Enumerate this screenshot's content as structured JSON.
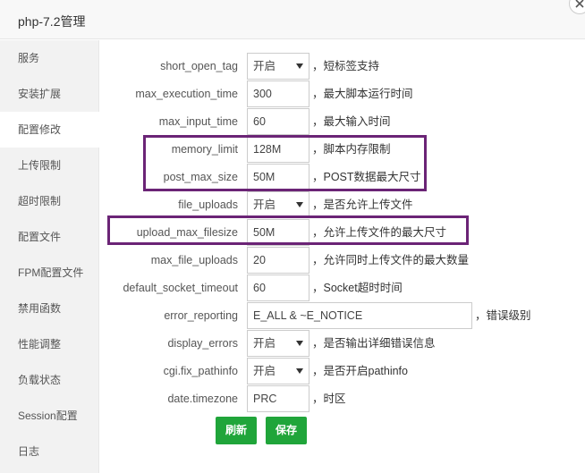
{
  "window": {
    "title": "php-7.2管理"
  },
  "sidebar": {
    "items": [
      {
        "label": "服务"
      },
      {
        "label": "安装扩展"
      },
      {
        "label": "配置修改"
      },
      {
        "label": "上传限制"
      },
      {
        "label": "超时限制"
      },
      {
        "label": "配置文件"
      },
      {
        "label": "FPM配置文件"
      },
      {
        "label": "禁用函数"
      },
      {
        "label": "性能调整"
      },
      {
        "label": "负载状态"
      },
      {
        "label": "Session配置"
      },
      {
        "label": "日志"
      }
    ]
  },
  "form": {
    "rows": [
      {
        "name": "short_open_tag",
        "type": "select",
        "value": "开启",
        "hint": "，短标签支持"
      },
      {
        "name": "max_execution_time",
        "type": "input",
        "value": "300",
        "hint": "，最大脚本运行时间"
      },
      {
        "name": "max_input_time",
        "type": "input",
        "value": "60",
        "hint": "，最大输入时间"
      },
      {
        "name": "memory_limit",
        "type": "input",
        "value": "128M",
        "hint": "，脚本内存限制"
      },
      {
        "name": "post_max_size",
        "type": "input",
        "value": "50M",
        "hint": "，POST数据最大尺寸"
      },
      {
        "name": "file_uploads",
        "type": "select",
        "value": "开启",
        "hint": "，是否允许上传文件"
      },
      {
        "name": "upload_max_filesize",
        "type": "input",
        "value": "50M",
        "hint": "，允许上传文件的最大尺寸"
      },
      {
        "name": "max_file_uploads",
        "type": "input",
        "value": "20",
        "hint": "，允许同时上传文件的最大数量"
      },
      {
        "name": "default_socket_timeout",
        "type": "input",
        "value": "60",
        "hint": "，Socket超时时间"
      },
      {
        "name": "error_reporting",
        "type": "input",
        "value": "E_ALL & ~E_NOTICE",
        "hint": "，错误级别"
      },
      {
        "name": "display_errors",
        "type": "select",
        "value": "开启",
        "hint": "，是否输出详细错误信息"
      },
      {
        "name": "cgi.fix_pathinfo",
        "type": "select",
        "value": "开启",
        "hint": "，是否开启pathinfo"
      },
      {
        "name": "date.timezone",
        "type": "input",
        "value": "PRC",
        "hint": "，时区"
      }
    ]
  },
  "buttons": {
    "refresh": "刷新",
    "save": "保存"
  },
  "colors": {
    "accent": "#20a53a",
    "highlight": "#6b2476"
  }
}
